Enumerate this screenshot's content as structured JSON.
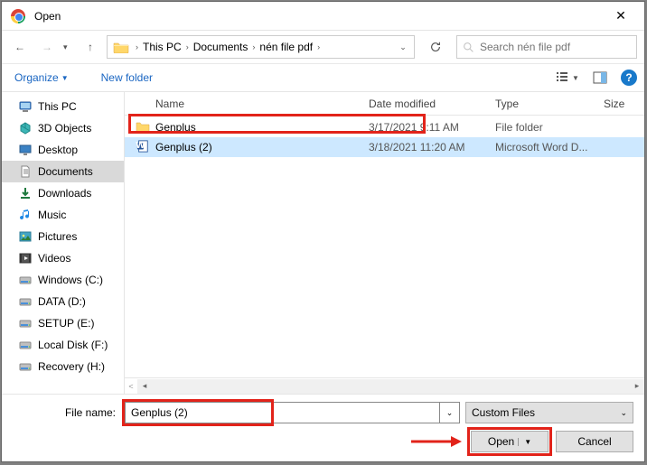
{
  "title": "Open",
  "nav": {
    "crumbs": [
      "This PC",
      "Documents",
      "nén file pdf"
    ],
    "search_placeholder": "Search nén file pdf"
  },
  "toolbar": {
    "organize": "Organize",
    "new_folder": "New folder"
  },
  "sidebar": {
    "items": [
      {
        "name": "This PC",
        "icon": "pc"
      },
      {
        "name": "3D Objects",
        "icon": "3d"
      },
      {
        "name": "Desktop",
        "icon": "desktop"
      },
      {
        "name": "Documents",
        "icon": "documents",
        "active": true
      },
      {
        "name": "Downloads",
        "icon": "downloads"
      },
      {
        "name": "Music",
        "icon": "music"
      },
      {
        "name": "Pictures",
        "icon": "pictures"
      },
      {
        "name": "Videos",
        "icon": "videos"
      },
      {
        "name": "Windows (C:)",
        "icon": "disk"
      },
      {
        "name": "DATA (D:)",
        "icon": "disk"
      },
      {
        "name": "SETUP (E:)",
        "icon": "disk"
      },
      {
        "name": "Local Disk (F:)",
        "icon": "disk"
      },
      {
        "name": "Recovery (H:)",
        "icon": "disk"
      }
    ]
  },
  "columns": {
    "name": "Name",
    "date": "Date modified",
    "type": "Type",
    "size": "Size"
  },
  "rows": [
    {
      "name": "Genplus",
      "date": "3/17/2021 9:11 AM",
      "type": "File folder",
      "icon": "folder",
      "selected": false
    },
    {
      "name": "Genplus (2)",
      "date": "3/18/2021 11:20 AM",
      "type": "Microsoft Word D...",
      "icon": "word",
      "selected": true
    }
  ],
  "filename_label": "File name:",
  "filename_value": "Genplus (2)",
  "type_filter": "Custom Files",
  "buttons": {
    "open": "Open",
    "cancel": "Cancel"
  }
}
